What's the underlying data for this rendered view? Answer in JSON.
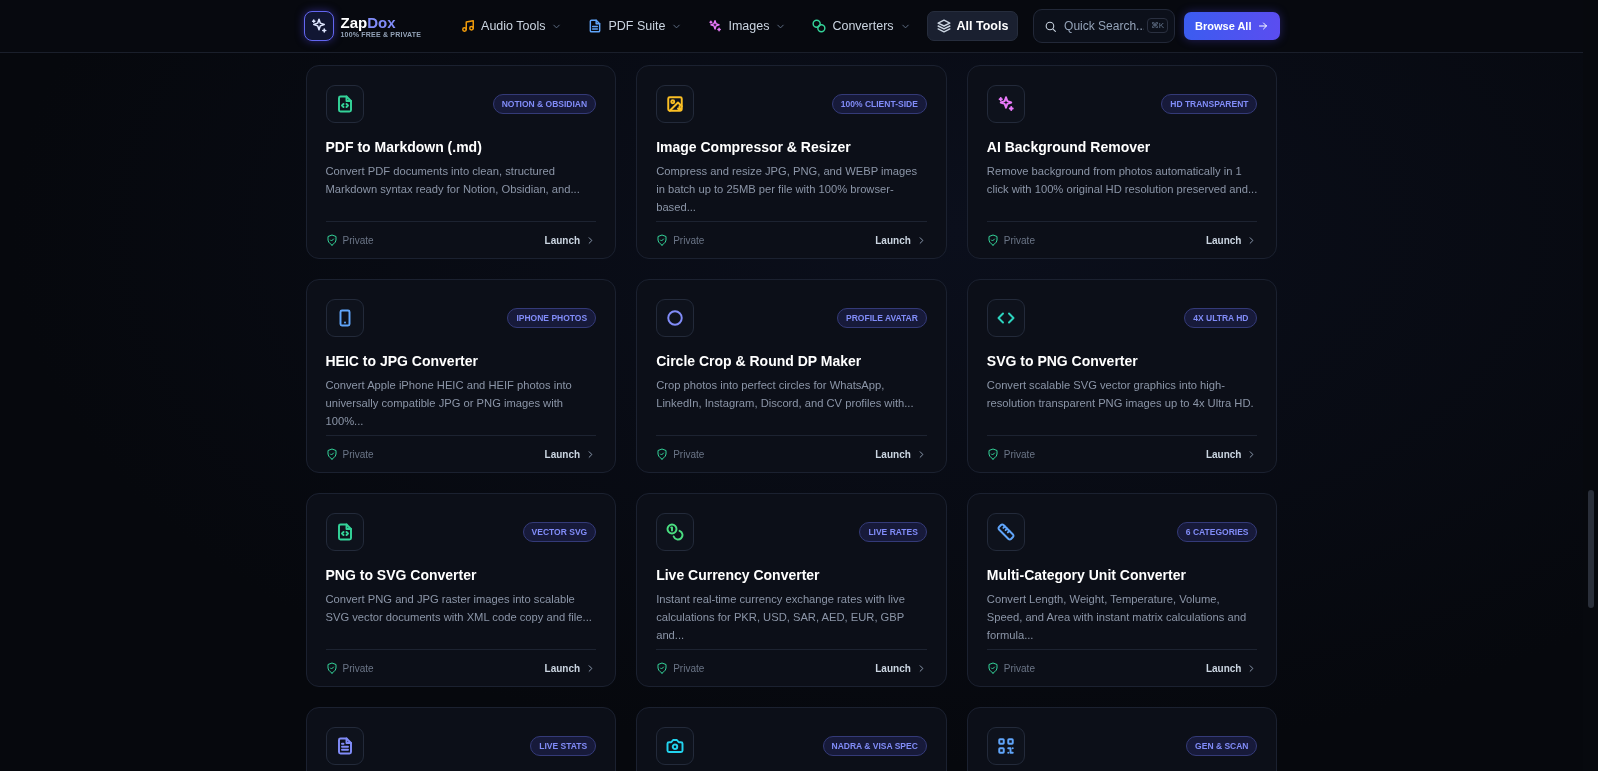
{
  "header": {
    "logo": {
      "name_first": "Zap",
      "name_second": "Dox",
      "tagline": "100% FREE & PRIVATE"
    },
    "nav": [
      {
        "label": "Audio Tools",
        "color": "#f59e0b",
        "has_menu": true,
        "selected": false
      },
      {
        "label": "PDF Suite",
        "color": "#60a5fa",
        "has_menu": true,
        "selected": false
      },
      {
        "label": "Images",
        "color": "#e879f9",
        "has_menu": true,
        "selected": false
      },
      {
        "label": "Converters",
        "color": "#34d399",
        "has_menu": true,
        "selected": false
      },
      {
        "label": "All Tools",
        "color": "#cbd5e1",
        "has_menu": false,
        "selected": true
      }
    ],
    "search": {
      "placeholder": "Quick Search...",
      "shortcut": "⌘K"
    },
    "browse_button": "Browse All"
  },
  "tools": [
    {
      "title": "PDF to Markdown (.md)",
      "badge": "NOTION & OBSIDIAN",
      "color": "#34d399",
      "description": "Convert PDF documents into clean, structured Markdown syntax ready for Notion, Obsidian, and...",
      "privacy": "Private",
      "action": "Launch"
    },
    {
      "title": "Image Compressor & Resizer",
      "badge": "100% CLIENT-SIDE",
      "color": "#fbbf24",
      "description": "Compress and resize JPG, PNG, and WEBP images in batch up to 25MB per file with 100% browser-based...",
      "privacy": "Private",
      "action": "Launch"
    },
    {
      "title": "AI Background Remover",
      "badge": "HD TRANSPARENT",
      "color": "#e879f9",
      "description": "Remove background from photos automatically in 1 click with 100% original HD resolution preserved and...",
      "privacy": "Private",
      "action": "Launch"
    },
    {
      "title": "HEIC to JPG Converter",
      "badge": "IPHONE PHOTOS",
      "color": "#60a5fa",
      "description": "Convert Apple iPhone HEIC and HEIF photos into universally compatible JPG or PNG images with 100%...",
      "privacy": "Private",
      "action": "Launch"
    },
    {
      "title": "Circle Crop & Round DP Maker",
      "badge": "PROFILE AVATAR",
      "color": "#818cf8",
      "description": "Crop photos into perfect circles for WhatsApp, LinkedIn, Instagram, Discord, and CV profiles with...",
      "privacy": "Private",
      "action": "Launch"
    },
    {
      "title": "SVG to PNG Converter",
      "badge": "4X ULTRA HD",
      "color": "#2dd4bf",
      "description": "Convert scalable SVG vector graphics into high-resolution transparent PNG images up to 4x Ultra HD.",
      "privacy": "Private",
      "action": "Launch"
    },
    {
      "title": "PNG to SVG Converter",
      "badge": "VECTOR SVG",
      "color": "#34d399",
      "description": "Convert PNG and JPG raster images into scalable SVG vector documents with XML code copy and file...",
      "privacy": "Private",
      "action": "Launch"
    },
    {
      "title": "Live Currency Converter",
      "badge": "LIVE RATES",
      "color": "#4ade80",
      "description": "Instant real-time currency exchange rates with live calculations for PKR, USD, SAR, AED, EUR, GBP and...",
      "privacy": "Private",
      "action": "Launch"
    },
    {
      "title": "Multi-Category Unit Converter",
      "badge": "6 CATEGORIES",
      "color": "#60a5fa",
      "description": "Convert Length, Weight, Temperature, Volume, Speed, and Area with instant matrix calculations and formula...",
      "privacy": "Private",
      "action": "Launch"
    },
    {
      "badge": "LIVE STATS",
      "color": "#818cf8"
    },
    {
      "badge": "NADRA & VISA SPEC",
      "color": "#22d3ee"
    },
    {
      "badge": "GEN & SCAN",
      "color": "#60a5fa"
    }
  ]
}
